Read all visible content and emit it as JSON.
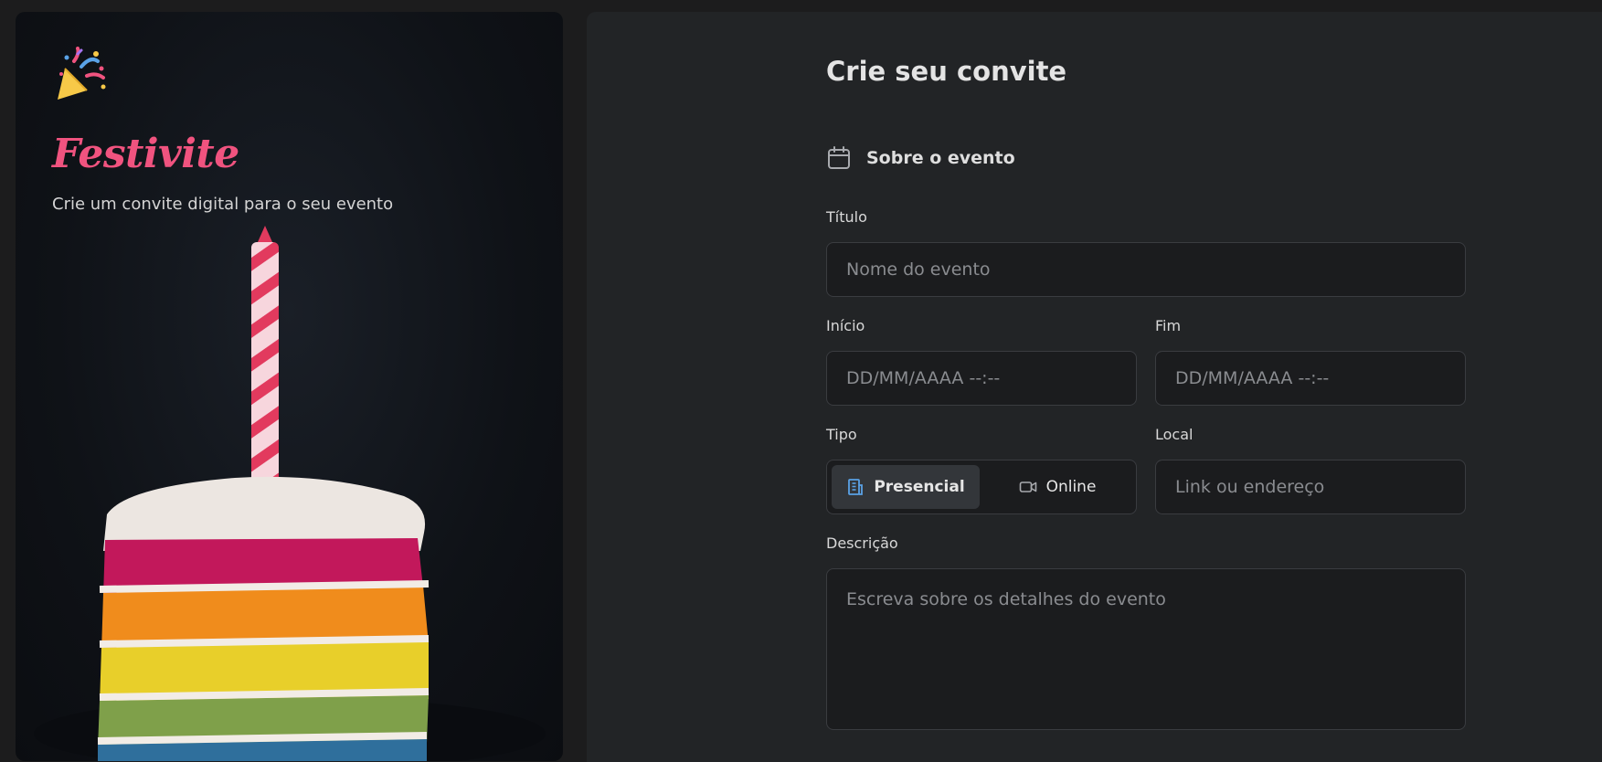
{
  "brand": {
    "name": "Festivite",
    "tagline": "Crie um convite digital para o seu evento",
    "logo_icon": "party-popper-icon"
  },
  "form": {
    "title": "Crie seu convite",
    "section": {
      "icon": "calendar-icon",
      "label": "Sobre o evento"
    },
    "titulo": {
      "label": "Título",
      "placeholder": "Nome do evento"
    },
    "inicio": {
      "label": "Início",
      "placeholder": "DD/MM/AAAA  --:--"
    },
    "fim": {
      "label": "Fim",
      "placeholder": "DD/MM/AAAA  --:--"
    },
    "tipo": {
      "label": "Tipo",
      "options": [
        {
          "label": "Presencial",
          "icon": "building-icon",
          "selected": true
        },
        {
          "label": "Online",
          "icon": "video-camera-icon",
          "selected": false
        }
      ]
    },
    "local": {
      "label": "Local",
      "placeholder": "Link ou endereço"
    },
    "descricao": {
      "label": "Descrição",
      "placeholder": "Escreva sobre os detalhes do evento"
    }
  },
  "colors": {
    "brand_pink": "#f0537f",
    "panel_bg": "#222426",
    "input_bg": "#1b1c1e",
    "accent_blue": "#5aa2e6"
  }
}
